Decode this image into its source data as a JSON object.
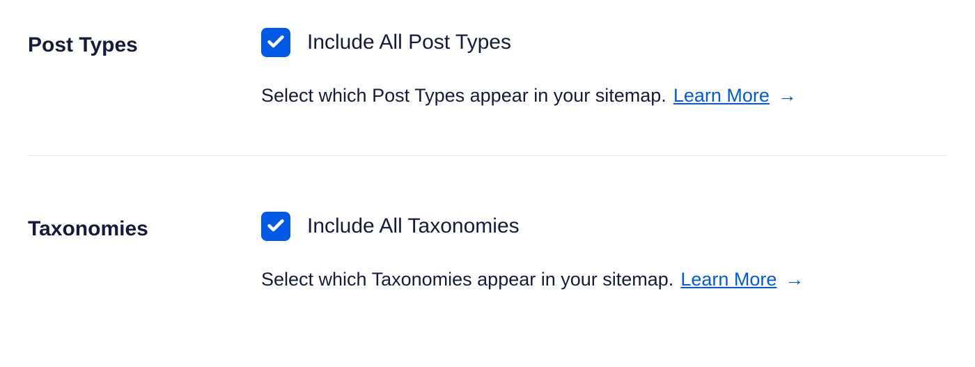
{
  "postTypes": {
    "heading": "Post Types",
    "checkboxLabel": "Include All Post Types",
    "checked": true,
    "description": "Select which Post Types appear in your sitemap.",
    "learnMore": "Learn More"
  },
  "taxonomies": {
    "heading": "Taxonomies",
    "checkboxLabel": "Include All Taxonomies",
    "checked": true,
    "description": "Select which Taxonomies appear in your sitemap.",
    "learnMore": "Learn More"
  },
  "colors": {
    "accent": "#005ae6",
    "text": "#141b3c",
    "divider": "#e8e8e8"
  }
}
